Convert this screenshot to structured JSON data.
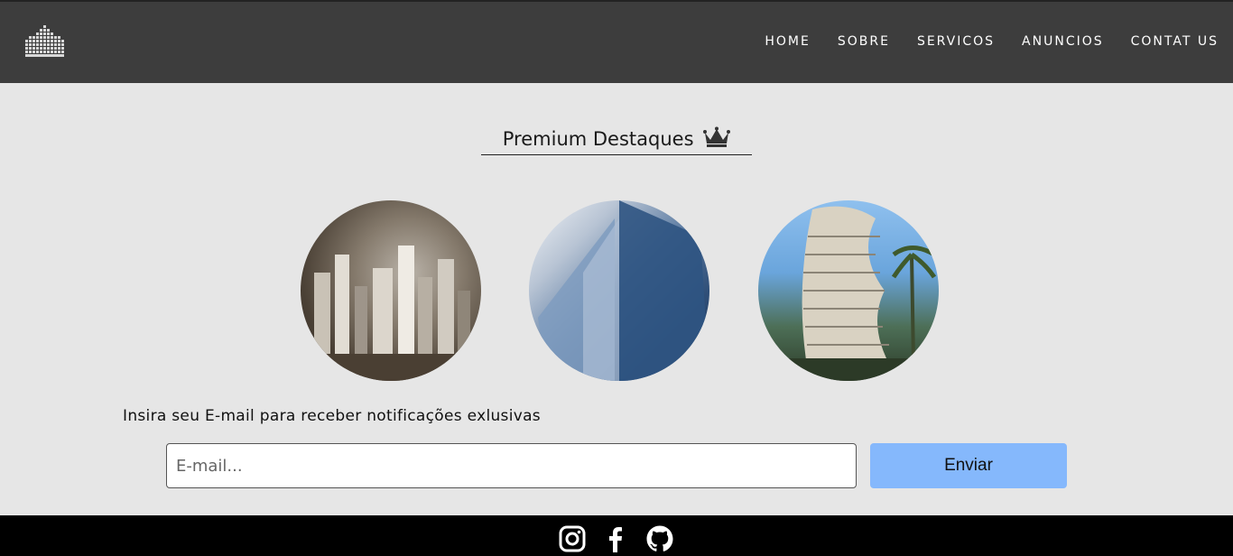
{
  "header": {
    "logo_icon": "building-grid-icon",
    "nav": [
      {
        "label": "HOME"
      },
      {
        "label": "SOBRE"
      },
      {
        "label": "SERVICOS"
      },
      {
        "label": "ANUNCIOS"
      },
      {
        "label": "CONTAT US"
      }
    ]
  },
  "featured": {
    "title": "Premium Destaques",
    "title_icon": "crown-icon",
    "images": [
      {
        "name": "city-skyline-image"
      },
      {
        "name": "glass-tower-image"
      },
      {
        "name": "curved-building-image"
      }
    ]
  },
  "newsletter": {
    "label": "Insira seu E-mail para receber notificações exlusivas",
    "placeholder": "E-mail...",
    "button_label": "Enviar"
  },
  "footer": {
    "icons": [
      "instagram-icon",
      "facebook-icon",
      "github-icon"
    ]
  },
  "colors": {
    "header_bg": "#3d3d3d",
    "page_bg": "#e6e6e6",
    "button_bg": "#85b8fc",
    "footer_bg": "#000000"
  }
}
